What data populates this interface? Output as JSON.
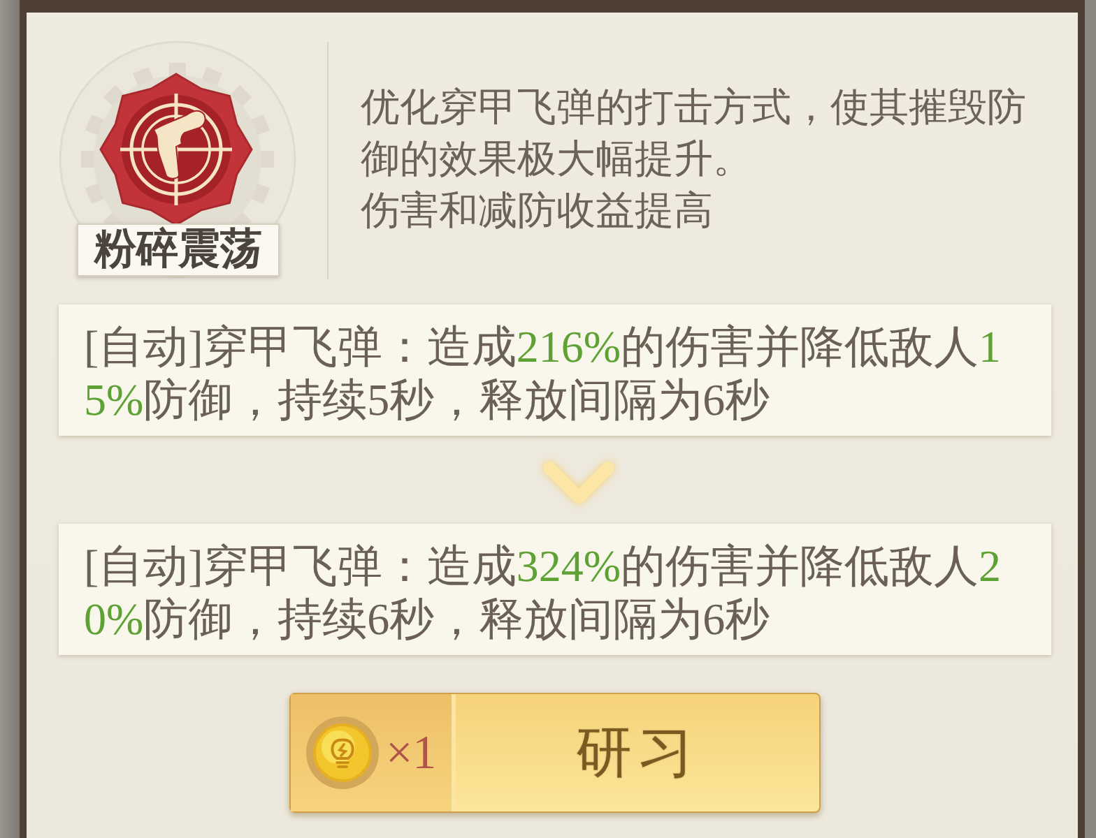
{
  "skill": {
    "name": "粉碎震荡",
    "description": [
      "优化穿甲飞弹的打击方式，使其摧毁防御的效果极大幅提升。",
      "伤害和减防收益提高"
    ]
  },
  "effects": [
    {
      "segments": [
        {
          "text": "[自动]穿甲飞弹：造成",
          "highlight": false
        },
        {
          "text": "216%",
          "highlight": true
        },
        {
          "text": "的伤害并降低敌人",
          "highlight": false
        },
        {
          "text": "15%",
          "highlight": true
        },
        {
          "text": "防御，持续5秒，释放间隔为6秒",
          "highlight": false
        }
      ]
    },
    {
      "segments": [
        {
          "text": "[自动]穿甲飞弹：造成",
          "highlight": false
        },
        {
          "text": "324%",
          "highlight": true
        },
        {
          "text": "的伤害并降低敌人",
          "highlight": false
        },
        {
          "text": "20%",
          "highlight": true
        },
        {
          "text": "防御，持续6秒，释放间隔为6秒",
          "highlight": false
        }
      ]
    }
  ],
  "action": {
    "cost": "×1",
    "label": "研习"
  }
}
